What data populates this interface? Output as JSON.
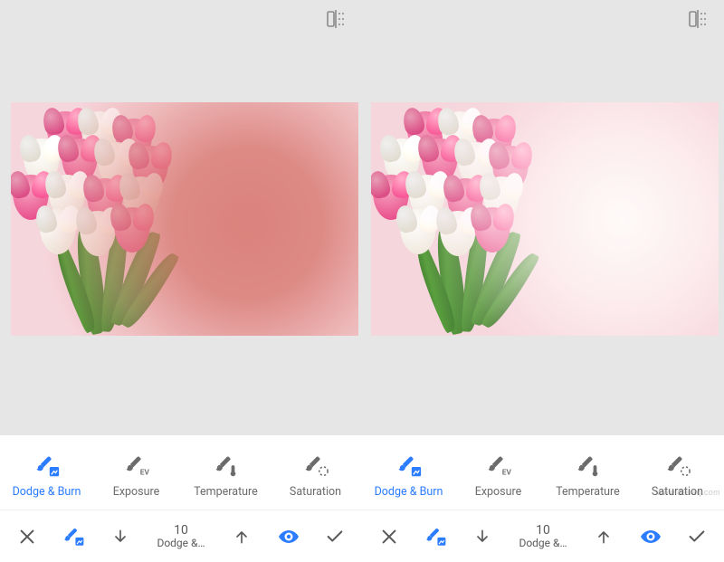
{
  "colors": {
    "accent": "#2b7cff",
    "muted": "#6b6b6b"
  },
  "compare_icon": "compare-before-after-icon",
  "panes": [
    {
      "id": "left",
      "tools": [
        {
          "key": "dodgeburn",
          "label": "Dodge & Burn",
          "active": true,
          "icon": "brush-dodge-icon"
        },
        {
          "key": "exposure",
          "label": "Exposure",
          "active": false,
          "icon": "brush-ev-icon"
        },
        {
          "key": "temperature",
          "label": "Temperature",
          "active": false,
          "icon": "brush-temp-icon"
        },
        {
          "key": "saturation",
          "label": "Saturation",
          "active": false,
          "icon": "brush-sat-icon"
        }
      ],
      "actions": {
        "close": "close-icon",
        "brush": "brush-dodge-icon",
        "decrease": "arrow-down-icon",
        "stepper_value": "10",
        "stepper_label": "Dodge &…",
        "increase": "arrow-up-icon",
        "visibility": "eye-icon",
        "apply": "check-icon"
      }
    },
    {
      "id": "right",
      "tools": [
        {
          "key": "dodgeburn",
          "label": "Dodge & Burn",
          "active": true,
          "icon": "brush-dodge-icon"
        },
        {
          "key": "exposure",
          "label": "Exposure",
          "active": false,
          "icon": "brush-ev-icon"
        },
        {
          "key": "temperature",
          "label": "Temperature",
          "active": false,
          "icon": "brush-temp-icon"
        },
        {
          "key": "saturation",
          "label": "Saturation",
          "active": false,
          "icon": "brush-sat-icon"
        }
      ],
      "actions": {
        "close": "close-icon",
        "brush": "brush-dodge-icon",
        "decrease": "arrow-down-icon",
        "stepper_value": "10",
        "stepper_label": "Dodge &…",
        "increase": "arrow-up-icon",
        "visibility": "eye-icon",
        "apply": "check-icon"
      }
    }
  ],
  "watermark": "www.deuaq.com"
}
